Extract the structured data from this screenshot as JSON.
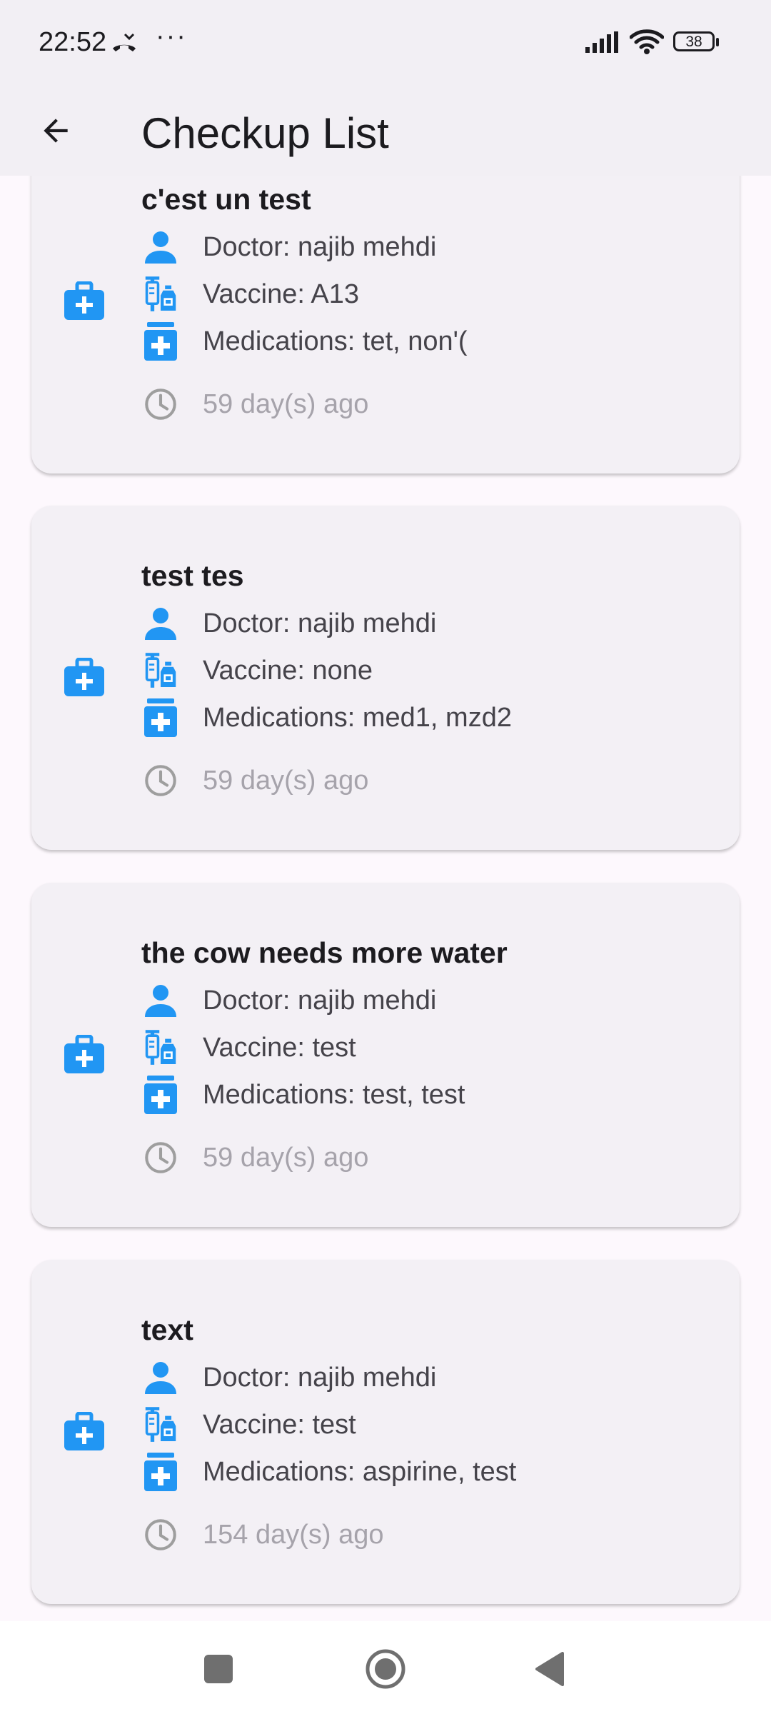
{
  "status_bar": {
    "time": "22:52",
    "dots": "···",
    "battery": "38"
  },
  "app_bar": {
    "title": "Checkup List",
    "back_icon": "arrow-back-icon"
  },
  "colors": {
    "accent": "#2196f3",
    "card_bg": "#f3f0f5",
    "muted": "#a6a3ab"
  },
  "checkups": [
    {
      "title": "c'est un test",
      "doctor": "Doctor: najib mehdi",
      "vaccine": "Vaccine: A13",
      "medications": "Medications: tet, non'(",
      "time_ago": "59 day(s) ago"
    },
    {
      "title": "test tes",
      "doctor": "Doctor: najib mehdi",
      "vaccine": "Vaccine: none",
      "medications": "Medications: med1, mzd2",
      "time_ago": "59 day(s) ago"
    },
    {
      "title": "the cow needs more water",
      "doctor": "Doctor: najib mehdi",
      "vaccine": "Vaccine: test",
      "medications": "Medications: test, test",
      "time_ago": "59 day(s) ago"
    },
    {
      "title": "text",
      "doctor": "Doctor: najib mehdi",
      "vaccine": "Vaccine: test",
      "medications": "Medications: aspirine, test",
      "time_ago": "154 day(s) ago"
    }
  ],
  "nav_bar": {
    "recents_icon": "square-icon",
    "home_icon": "circle-icon",
    "back_icon": "triangle-back-icon"
  }
}
